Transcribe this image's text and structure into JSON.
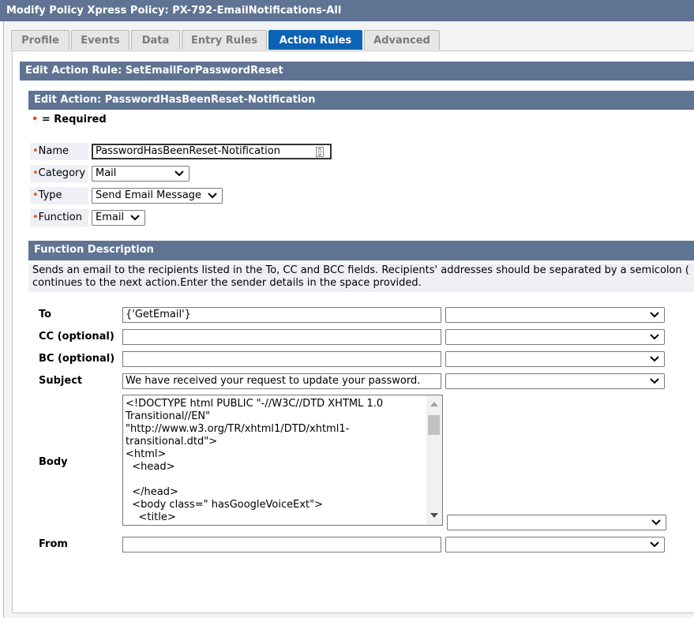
{
  "window": {
    "title": "Modify Policy Xpress Policy: PX-792-EmailNotifications-All"
  },
  "tabs": [
    {
      "label": "Profile",
      "active": false
    },
    {
      "label": "Events",
      "active": false
    },
    {
      "label": "Data",
      "active": false
    },
    {
      "label": "Entry Rules",
      "active": false
    },
    {
      "label": "Action Rules",
      "active": true
    },
    {
      "label": "Advanced",
      "active": false
    }
  ],
  "action_rule": {
    "header": "Edit Action Rule: SetEmailForPasswordReset"
  },
  "action": {
    "header": "Edit Action: PasswordHasBeenReset-Notification",
    "required_marker": "•",
    "required_text": " = Required",
    "fields": {
      "name": {
        "label": "Name",
        "value": "PasswordHasBeenReset-Notification"
      },
      "category": {
        "label": "Category",
        "value": "Mail"
      },
      "type": {
        "label": "Type",
        "value": "Send Email Message"
      },
      "function": {
        "label": "Function",
        "value": "Email"
      }
    }
  },
  "function_description": {
    "header": "Function Description",
    "line1": "Sends an email to the recipients listed in the To, CC and BCC fields. Recipients' addresses should be separated by a semicolon (",
    "line2": "continues to the next action.Enter the sender details in the space provided."
  },
  "email_form": {
    "to": {
      "label": "To",
      "value": "{'GetEmail'}",
      "select_value": ""
    },
    "cc": {
      "label": "CC (optional)",
      "value": "",
      "select_value": ""
    },
    "bc": {
      "label": "BC (optional)",
      "value": "",
      "select_value": ""
    },
    "subject": {
      "label": "Subject",
      "value": "We have received your request to update your password.",
      "select_value": ""
    },
    "body": {
      "label": "Body",
      "value": "<!DOCTYPE html PUBLIC \"-//W3C//DTD XHTML 1.0\nTransitional//EN\"\n\"http://www.w3.org/TR/xhtml1/DTD/xhtml1-\ntransitional.dtd\">\n<html>\n  <head>\n\n  </head>\n  <body class=\" hasGoogleVoiceExt\">\n    <title>",
      "select_value": ""
    },
    "from": {
      "label": "From",
      "value": "",
      "select_value": ""
    }
  },
  "colors": {
    "header_bg": "#5f7393",
    "active_tab": "#0c62b5",
    "required_dot": "#e05a10",
    "label_bg": "#eef0f6"
  },
  "icons": {
    "select_arrow": "chevron-down-icon",
    "name_field_icon": "field-lookup-icon"
  }
}
